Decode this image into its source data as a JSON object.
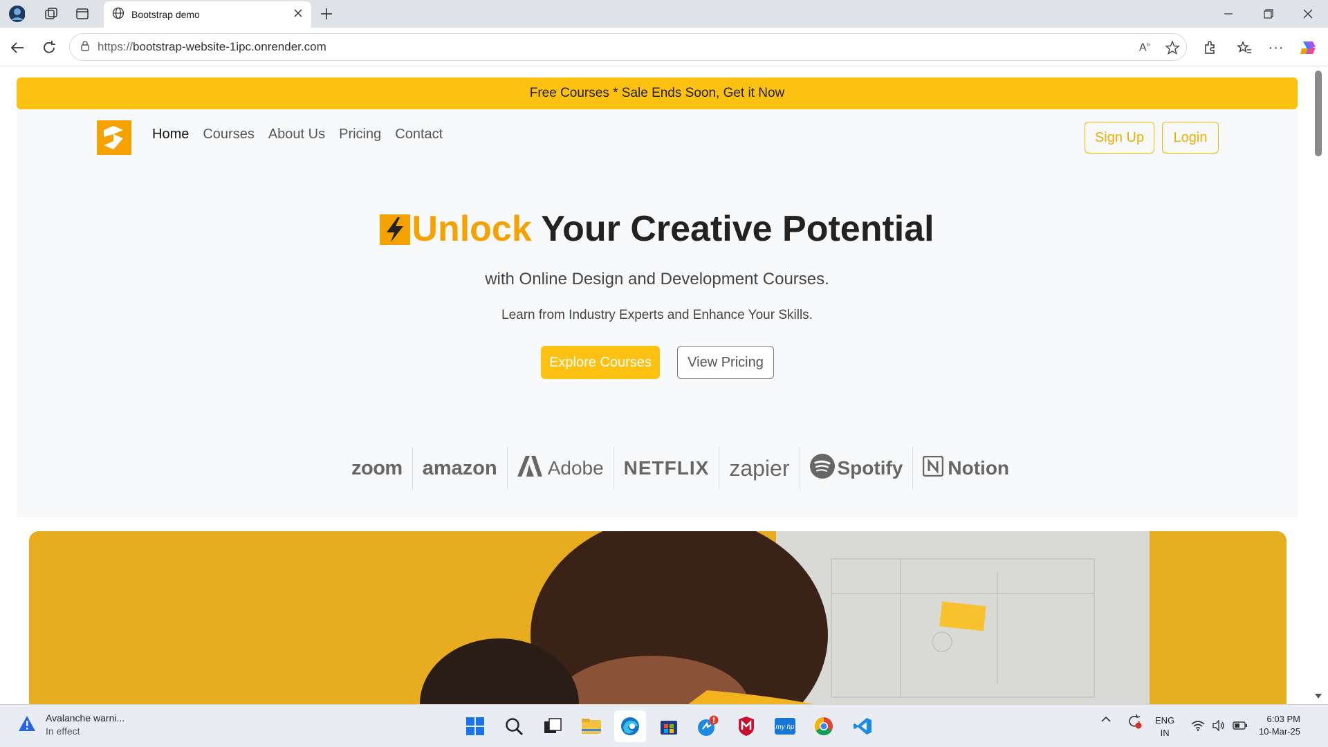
{
  "browser": {
    "tab_title": "Bootstrap demo",
    "url_prefix": "https://",
    "url_host": "bootstrap-website-1ipc.onrender.com"
  },
  "page": {
    "banner": "Free Courses * Sale Ends Soon, Get it Now",
    "nav": {
      "items": [
        "Home",
        "Courses",
        "About Us",
        "Pricing",
        "Contact"
      ],
      "signup": "Sign Up",
      "login": "Login"
    },
    "hero": {
      "title_accent": "Unlock",
      "title_rest": " Your Creative Potential",
      "subtitle": "with Online Design and Development Courses.",
      "tagline": "Learn from Industry Experts and Enhance Your Skills.",
      "primary_button": "Explore Courses",
      "secondary_button": "View Pricing"
    },
    "brands": [
      "zoom",
      "amazon",
      "Adobe",
      "NETFLIX",
      "zapier",
      "Spotify",
      "Notion"
    ],
    "colors": {
      "accent": "#fdc112",
      "accent_text": "#f5a100"
    }
  },
  "taskbar": {
    "notification_title": "Avalanche warni...",
    "notification_sub": "In effect",
    "language": "ENG",
    "region": "IN",
    "time": "6:03 PM",
    "date": "10-Mar-25"
  }
}
